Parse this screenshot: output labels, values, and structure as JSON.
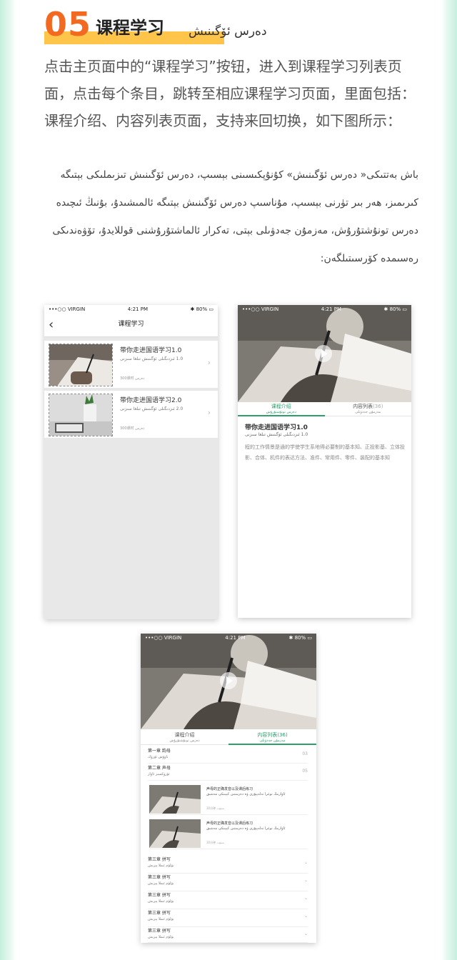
{
  "section": {
    "number": "05",
    "title": "课程学习",
    "title_ug": "دەرس ئۆگىنىش"
  },
  "description_cn": "点击主页面中的“课程学习”按钮，进入到课程学习列表页面，点击每个条目，跳转至相应课程学习页面，里面包括：课程介绍、内容列表页面，支持来回切换，如下图所示：",
  "description_ug": "باش بەتتىكى« دەرس ئۆگىنىش» كۇنۇپكىسىنى بېسىپ، دەرس ئۆگىنىش تىزىملىكى بېتىگە كىرىمىز، ھەر بىر تۈرنى بېسىپ، مۇناسىپ دەرس ئۆگىنىش بېتىگە ئالمىشىدۇ، بۇنىڭ ئىچىدە دەرس تونۇشتۇرۇش، مەزمۇن جەدۋىلى بېتى، تەكرار ئالماشتۇرۇشنى قوللايدۇ، تۆۋەندىكى رەسىمدە كۆرسىتىلگەن:",
  "status_bar": {
    "carrier": "•••○○ VIRGIN",
    "time": "4:21 PM",
    "battery": "80%"
  },
  "phone1": {
    "nav_back": "‹",
    "nav_title": "课程学习",
    "courses": [
      {
        "name": "带你走进国语学习1.0",
        "name_ug": "1.0 ئىزدىگىلى ئۆگىنىش تىلغا سىزنى",
        "meta": "300课时 دەرس"
      },
      {
        "name": "带你走进国语学习2.0",
        "name_ug": "2.0 ئىزدىگىلى ئۆگىنىش تىلغا سىزنى",
        "meta": "300课时 دەرس"
      }
    ],
    "arrow": "›"
  },
  "tabs": [
    {
      "label": "课程介绍",
      "label_ug": "دەرس تونۇشتۇرۇش"
    },
    {
      "label": "内容列表",
      "count": "(36)",
      "label_ug": "مەزمۇن جەدۋىلى"
    }
  ],
  "phone2": {
    "title": "带你走进国语学习1.0",
    "title_ug": "1.0 ئىزدىگىلى ئۆگىنىش تىلغا سىزنى",
    "intro": "程的工作情景是通的学使学生系地得必要制的基本知、正投影基、立体投影、合体、机件的表达方法、准件、常用件、零件、装配的基本知"
  },
  "phone3": {
    "chapters_top": [
      {
        "title": "第一章  韵母",
        "sub": "تاۋۇش  ئۈزۈك",
        "right": "03"
      },
      {
        "title": "第二章  声母",
        "sub": "ئۈزۈكسىز  ئاۋاز",
        "right": "05"
      }
    ],
    "lessons": [
      {
        "name": "声母的正确发音以及课后练习",
        "name_ug": "ئاۋازنىڭ توغرا تەلەپپۇزى ۋە دەرستىن كېيىنكى مەشىق",
        "duration": "30分钟 مىنۇت"
      },
      {
        "name": "声母的正确发音以及课后练习",
        "name_ug": "ئاۋازنىڭ توغرا تەلەپپۇزى ۋە دەرستىن كېيىنكى مەشىق",
        "duration": "30分钟 مىنۇت"
      }
    ],
    "chapters_bottom": [
      {
        "title": "第三章  拼写",
        "sub": "بۆلۈم  ئىملا يېزىش"
      },
      {
        "title": "第三章  拼写",
        "sub": "بۆلۈم  ئىملا يېزىش"
      },
      {
        "title": "第三章  拼写",
        "sub": "بۆلۈم  ئىملا يېزىش"
      },
      {
        "title": "第三章  拼写",
        "sub": "بۆلۈم  ئىملا يېزىش"
      },
      {
        "title": "第三章  拼写",
        "sub": "بۆلۈم  ئىملا يېزىش"
      }
    ],
    "chevron": "⌄"
  }
}
